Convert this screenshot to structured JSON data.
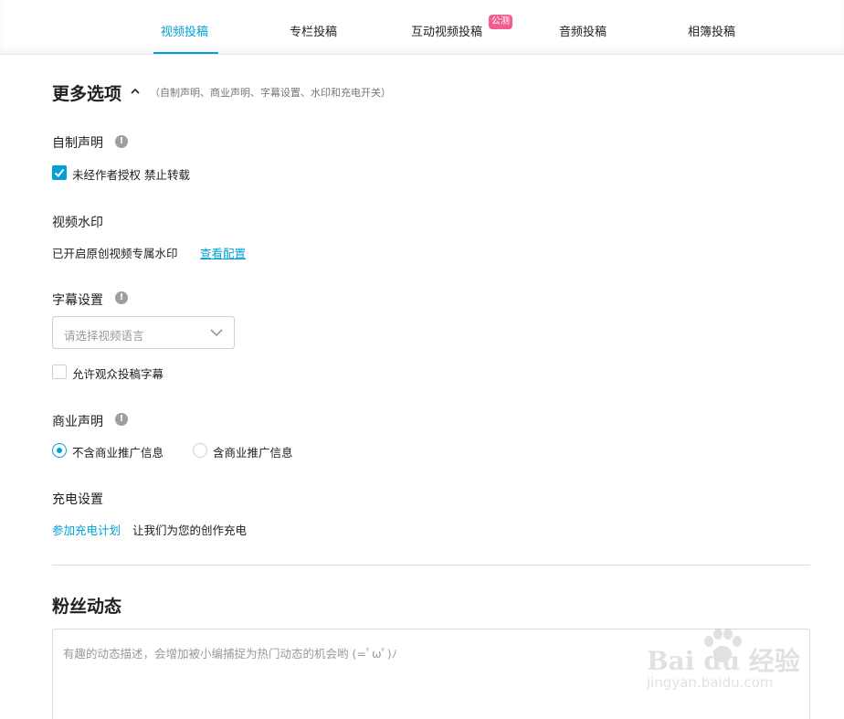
{
  "tabs": [
    {
      "label": "视频投稿",
      "active": true
    },
    {
      "label": "专栏投稿",
      "active": false
    },
    {
      "label": "互动视频投稿",
      "active": false,
      "badge": "公测"
    },
    {
      "label": "音频投稿",
      "active": false
    },
    {
      "label": "相簿投稿",
      "active": false
    }
  ],
  "more_options": {
    "title": "更多选项",
    "hint": "（自制声明、商业声明、字幕设置、水印和充电开关）"
  },
  "self_made": {
    "label": "自制声明",
    "info_glyph": "!",
    "checkbox_label": "未经作者授权 禁止转载",
    "checked": true
  },
  "watermark_setting": {
    "label": "视频水印",
    "text": "已开启原创视频专属水印",
    "link": "查看配置"
  },
  "subtitle": {
    "label": "字幕设置",
    "info_glyph": "!",
    "select_placeholder": "请选择视频语言",
    "allow_label": "允许观众投稿字幕",
    "allow_checked": false
  },
  "commercial": {
    "label": "商业声明",
    "info_glyph": "!",
    "options": [
      {
        "label": "不含商业推广信息",
        "selected": true
      },
      {
        "label": "含商业推广信息",
        "selected": false
      }
    ]
  },
  "charge": {
    "label": "充电设置",
    "link": "参加充电计划",
    "text": "让我们为您的创作充电"
  },
  "fan_dynamic": {
    "title": "粉丝动态",
    "placeholder": "有趣的动态描述，会增加被小编捕捉为热门动态的机会哟 (=ﾟωﾟ)ﾉ"
  },
  "site_watermark": {
    "main": "Bai du 经验",
    "sub": "jingyan.baidu.com"
  },
  "colors": {
    "accent": "#00a1d6",
    "badge": "#f25d8e",
    "text": "#212121",
    "muted": "#999999"
  }
}
